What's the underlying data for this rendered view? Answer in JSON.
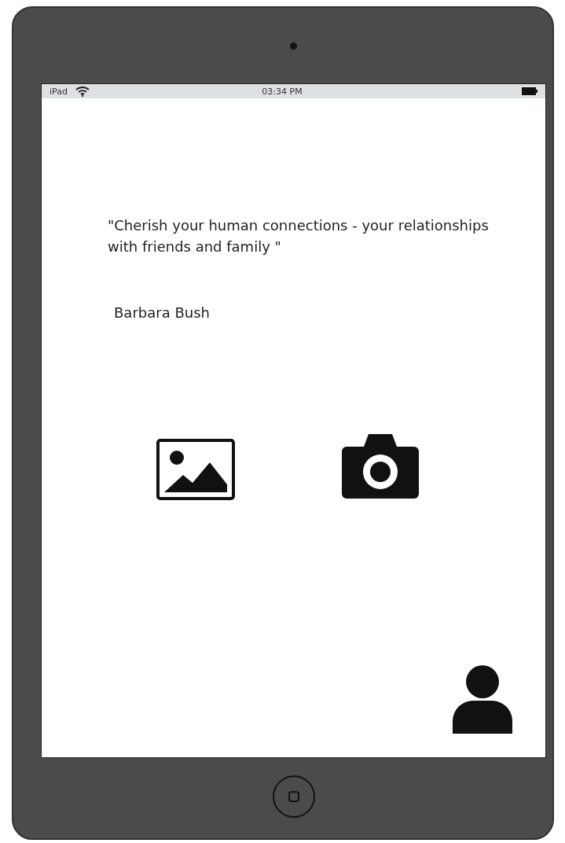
{
  "status_bar": {
    "device": "iPad",
    "time": "03:34 PM"
  },
  "quote": {
    "text": "\"Cherish your human connections - your relationships with friends and family \"",
    "author": "Barbara Bush"
  }
}
